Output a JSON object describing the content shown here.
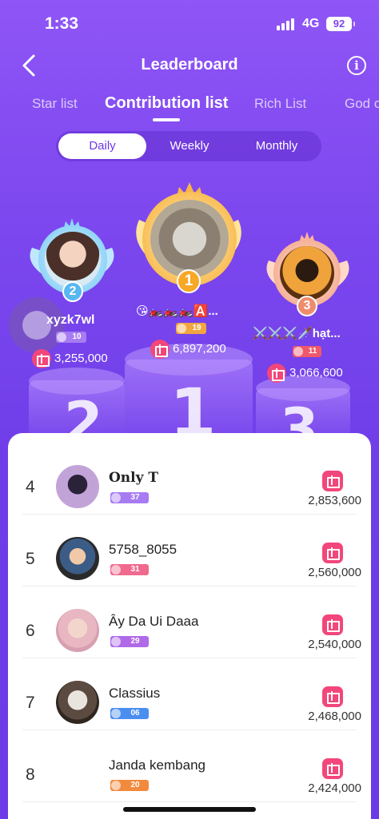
{
  "status": {
    "time": "1:33",
    "network": "4G",
    "battery": "92"
  },
  "header": {
    "title": "Leaderboard",
    "back_icon": "chevron-left-icon",
    "info_icon": "info-icon"
  },
  "tabs": [
    "Star list",
    "Contribution list",
    "Rich List",
    "God c"
  ],
  "period": {
    "options": [
      "Daily",
      "Weekly",
      "Monthly"
    ],
    "selected": "Daily"
  },
  "podium": {
    "numbers": [
      "2",
      "1",
      "3"
    ],
    "first": {
      "rank": "1",
      "name": "😘🏍️🏍️🏍️🅰️...",
      "level": "19",
      "score": "6,897,200"
    },
    "second": {
      "rank": "2",
      "name": "xyzk7wl",
      "level": "10",
      "score": "3,255,000"
    },
    "third": {
      "rank": "3",
      "name": "⚔️⚔️⚔️🗡️hạt...",
      "level": "11",
      "score": "3,066,600"
    }
  },
  "list": [
    {
      "rank": "4",
      "name": "Only T",
      "level": "37",
      "value": "2,853,600",
      "level_color": "#a77cf2"
    },
    {
      "rank": "5",
      "name": "5758_8055",
      "level": "31",
      "value": "2,560,000",
      "level_color": "#f06a8e"
    },
    {
      "rank": "6",
      "name": "Ây Da Ui Daaa",
      "level": "29",
      "value": "2,540,000",
      "level_color": "#b06ae8"
    },
    {
      "rank": "7",
      "name": "Classius",
      "level": "06",
      "value": "2,468,000",
      "level_color": "#4a8ef0"
    },
    {
      "rank": "8",
      "name": "Janda kembang",
      "level": "20",
      "value": "2,424,000",
      "level_color": "#f28a3e"
    }
  ]
}
